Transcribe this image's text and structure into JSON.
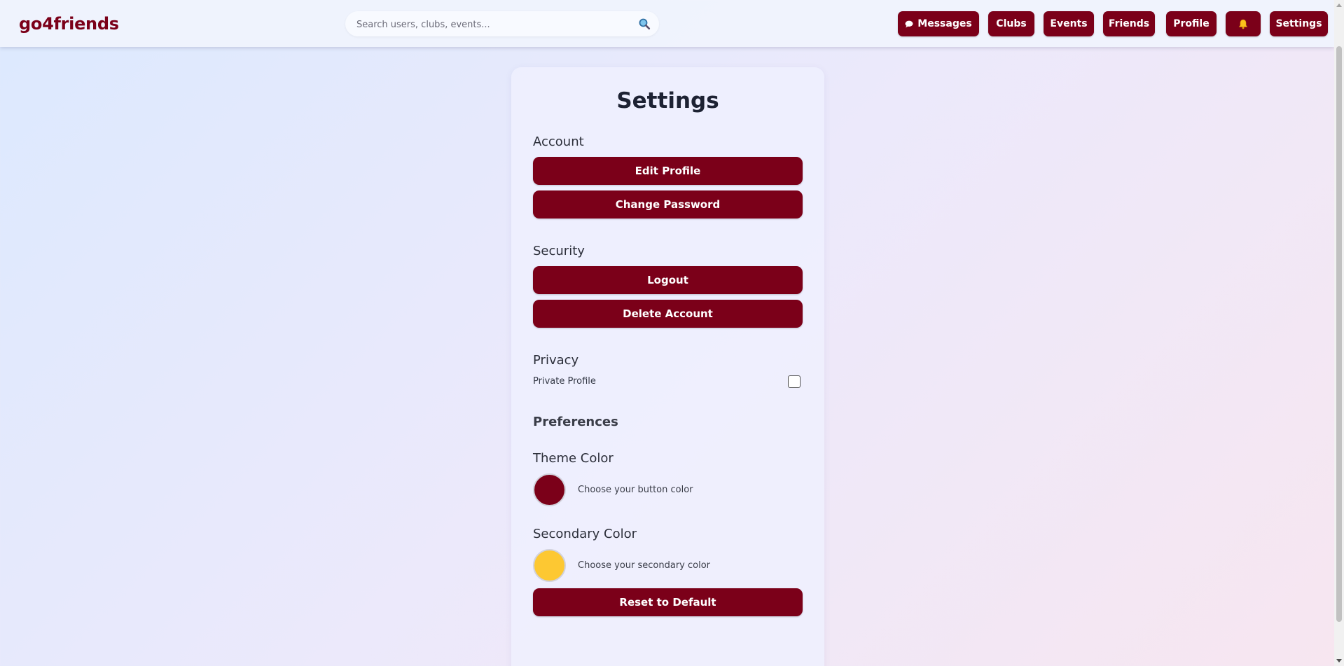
{
  "header": {
    "logo": "go4friends",
    "search_placeholder": "Search users, clubs, events...",
    "nav": {
      "messages": "Messages",
      "clubs": "Clubs",
      "events": "Events",
      "friends": "Friends",
      "profile": "Profile",
      "settings": "Settings"
    }
  },
  "settings": {
    "title": "Settings",
    "account": {
      "heading": "Account",
      "edit_profile": "Edit Profile",
      "change_password": "Change Password"
    },
    "security": {
      "heading": "Security",
      "logout": "Logout",
      "delete_account": "Delete Account"
    },
    "privacy": {
      "heading": "Privacy",
      "private_profile_label": "Private Profile",
      "private_profile_checked": false
    },
    "preferences": {
      "heading": "Preferences",
      "theme_color": {
        "heading": "Theme Color",
        "description": "Choose your button color",
        "value": "#7b0019"
      },
      "secondary_color": {
        "heading": "Secondary Color",
        "description": "Choose your secondary color",
        "value": "#fdc832"
      },
      "reset": "Reset to Default"
    }
  },
  "colors": {
    "accent": "#7b0019",
    "secondary": "#fdc832"
  },
  "icons": {
    "messages": "speech-bubble-icon",
    "search": "magnifier-icon",
    "notifications": "bell-icon"
  }
}
